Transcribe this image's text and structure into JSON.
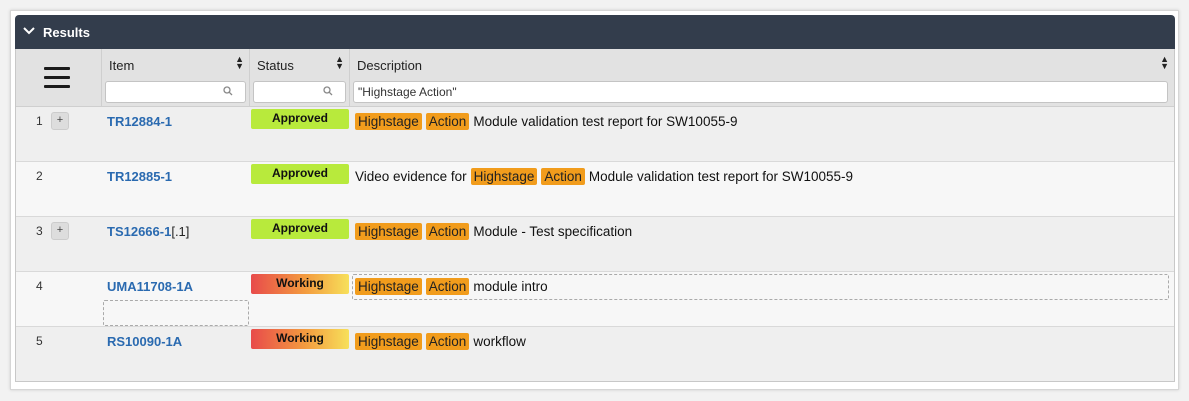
{
  "panel": {
    "title": "Results",
    "collapse_icon": "chevron-down-icon"
  },
  "columns": {
    "item": {
      "label": "Item",
      "filter_value": "",
      "filter_placeholder": ""
    },
    "status": {
      "label": "Status",
      "filter_value": ""
    },
    "description": {
      "label": "Description",
      "filter_value": "\"Highstage Action\""
    }
  },
  "rows": [
    {
      "num": "1",
      "has_expand": true,
      "item": "TR12884-1",
      "item_suffix": "",
      "status": "Approved",
      "desc_pre": "",
      "hl1": "Highstage",
      "hl2": "Action",
      "desc_post": "Module validation test report for SW10055-9"
    },
    {
      "num": "2",
      "has_expand": false,
      "item": "TR12885-1",
      "item_suffix": "",
      "status": "Approved",
      "desc_pre": "Video evidence for",
      "hl1": "Highstage",
      "hl2": "Action",
      "desc_post": "Module validation test report for SW10055-9"
    },
    {
      "num": "3",
      "has_expand": true,
      "item": "TS12666-1",
      "item_suffix": "[.1]",
      "status": "Approved",
      "desc_pre": "",
      "hl1": "Highstage",
      "hl2": "Action",
      "desc_post": "Module - Test specification"
    },
    {
      "num": "4",
      "has_expand": false,
      "item": "UMA11708-1A",
      "item_suffix": "",
      "status": "Working",
      "desc_pre": "",
      "hl1": "Highstage",
      "hl2": "Action",
      "desc_post": "module intro"
    },
    {
      "num": "5",
      "has_expand": false,
      "item": "RS10090-1A",
      "item_suffix": "",
      "status": "Working",
      "desc_pre": "",
      "hl1": "Highstage",
      "hl2": "Action",
      "desc_post": "workflow"
    }
  ],
  "expand_label": "+",
  "colors": {
    "header_bg": "#333d4c",
    "approved": "#b8ea3c",
    "highlight": "#f19c1c",
    "link": "#2a6ab0"
  }
}
